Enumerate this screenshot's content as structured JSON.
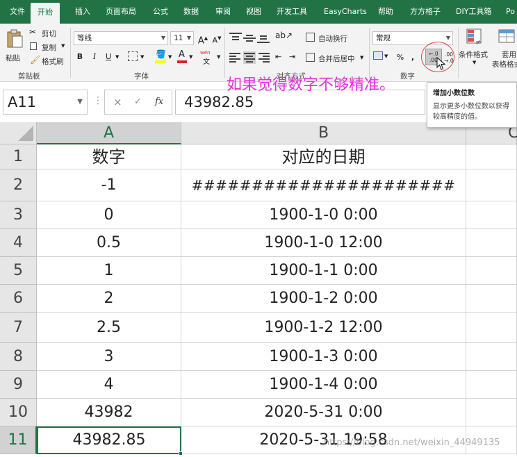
{
  "tabs": [
    {
      "label": "文件",
      "active": false
    },
    {
      "label": "开始",
      "active": true
    },
    {
      "label": "插入",
      "active": false
    },
    {
      "label": "页面布局",
      "active": false
    },
    {
      "label": "公式",
      "active": false
    },
    {
      "label": "数据",
      "active": false
    },
    {
      "label": "审阅",
      "active": false
    },
    {
      "label": "视图",
      "active": false
    },
    {
      "label": "开发工具",
      "active": false
    },
    {
      "label": "EasyCharts",
      "active": false
    },
    {
      "label": "帮助",
      "active": false
    },
    {
      "label": "方方格子",
      "active": false
    },
    {
      "label": "DIY工具箱",
      "active": false
    },
    {
      "label": "Po",
      "active": false
    }
  ],
  "ribbon": {
    "clipboard": {
      "paste": "粘贴",
      "cut": "剪切",
      "copy": "复制",
      "format_painter": "格式刷",
      "group_label": "剪贴板"
    },
    "font": {
      "font_name": "等线",
      "font_size": "11",
      "grow": "A",
      "shrink": "A",
      "bold": "B",
      "italic": "I",
      "underline": "U",
      "font_color_letter": "A",
      "phonetic": "wén",
      "group_label": "字体"
    },
    "alignment": {
      "wrap_text": "自动换行",
      "merge_center": "合并后居中",
      "group_label": "对齐方式"
    },
    "number": {
      "format": "常规",
      "percent": "%",
      "comma": ",",
      "increase_decimal_top": "←.0",
      "increase_decimal_bottom": ".00",
      "decrease_decimal_top": ".00",
      "decrease_decimal_bottom": "→.0",
      "group_label": "数字"
    },
    "styles": {
      "conditional_format": "条件格式",
      "table_format_line1": "套用",
      "table_format_line2": "表格格式"
    }
  },
  "tooltip": {
    "title": "增加小数位数",
    "desc": "显示更多小数位数以获得较高精度的值。"
  },
  "annotation": "如果觉得数字不够精准。",
  "formula_bar": {
    "name_box": "A11",
    "cancel": "×",
    "enter": "✓",
    "fx": "fx",
    "value": "43982.85"
  },
  "grid": {
    "columns": [
      "A",
      "B",
      "C"
    ],
    "selected_column": "A",
    "selected_row": "11",
    "rows": [
      {
        "row": "1",
        "a": "数字",
        "b": "对应的日期"
      },
      {
        "row": "2",
        "a": "-1",
        "b": "######################"
      },
      {
        "row": "3",
        "a": "0",
        "b": "1900-1-0 0:00"
      },
      {
        "row": "4",
        "a": "0.5",
        "b": "1900-1-0 12:00"
      },
      {
        "row": "5",
        "a": "1",
        "b": "1900-1-1 0:00"
      },
      {
        "row": "6",
        "a": "2",
        "b": "1900-1-2 0:00"
      },
      {
        "row": "7",
        "a": "2.5",
        "b": "1900-1-2 12:00"
      },
      {
        "row": "8",
        "a": "3",
        "b": "1900-1-3 0:00"
      },
      {
        "row": "9",
        "a": "4",
        "b": "1900-1-4 0:00"
      },
      {
        "row": "10",
        "a": "43982",
        "b": "2020-5-31 0:00"
      },
      {
        "row": "11",
        "a": "43982.85",
        "b": "2020-5-31 19:58"
      }
    ]
  },
  "watermark": "https://blog.csdn.net/weixin_44949135",
  "colors": {
    "excel_green": "#217346",
    "annotation_magenta": "#e030d8",
    "circle_red": "#e04040"
  }
}
